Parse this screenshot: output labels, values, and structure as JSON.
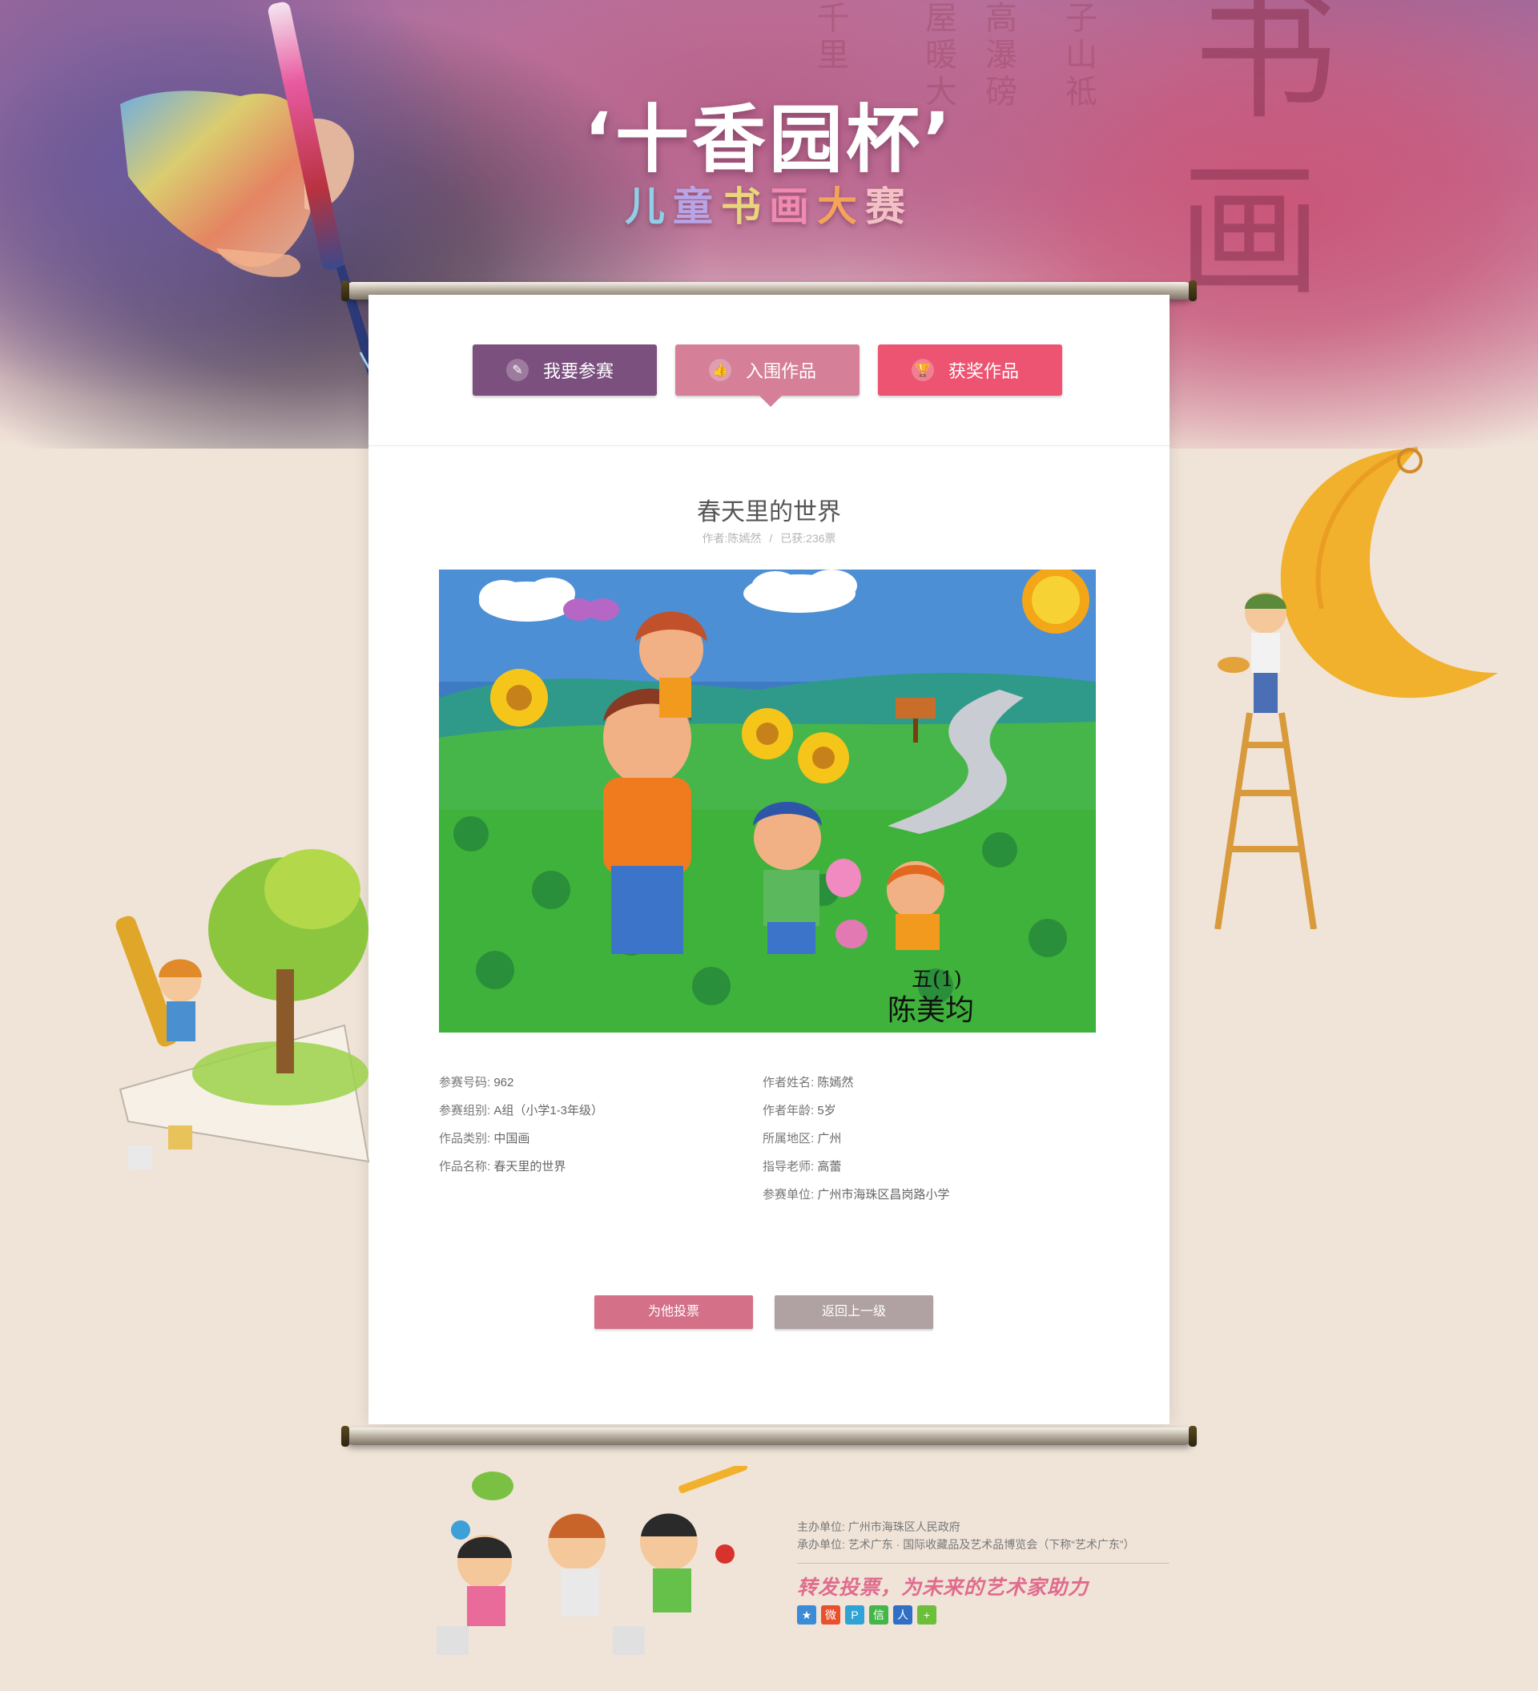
{
  "banner": {
    "title": "‘十香园杯’",
    "subtitle": [
      {
        "text": "儿",
        "color": "#8fcfe8"
      },
      {
        "text": "童",
        "color": "#b9a4e6"
      },
      {
        "text": "书",
        "color": "#e9d57a"
      },
      {
        "text": "画",
        "color": "#f08ab0"
      },
      {
        "text": "大",
        "color": "#f5a35a"
      },
      {
        "text": "赛",
        "color": "#f3c0c6"
      }
    ],
    "callig_1": "书",
    "callig_2": "画",
    "poem_cols": [
      "子山祗",
      "高瀑磅",
      "屋暖大",
      "千里"
    ]
  },
  "tabs": [
    {
      "label": "我要参赛",
      "icon": "brush-icon",
      "glyph": "✎"
    },
    {
      "label": "入围作品",
      "icon": "thumbs-up-icon",
      "glyph": "👍"
    },
    {
      "label": "获奖作品",
      "icon": "trophy-icon",
      "glyph": "🏆"
    }
  ],
  "work": {
    "title": "春天里的世界",
    "author_meta": "作者:陈嫣然",
    "votes_meta": "已获:236票",
    "artwork_signature_1": "五(1)",
    "artwork_signature_2": "陈美均"
  },
  "info_left": [
    {
      "k": "参赛号码:",
      "v": "962"
    },
    {
      "k": "参赛组别:",
      "v": "A组（小学1-3年级）"
    },
    {
      "k": "作品类别:",
      "v": "中国画"
    },
    {
      "k": "作品名称:",
      "v": "春天里的世界"
    }
  ],
  "info_right": [
    {
      "k": "作者姓名:",
      "v": "陈嫣然"
    },
    {
      "k": "作者年龄:",
      "v": "5岁"
    },
    {
      "k": "所属地区:",
      "v": "广州"
    },
    {
      "k": "指导老师:",
      "v": "高蕾"
    },
    {
      "k": "参赛单位:",
      "v": "广州市海珠区昌岗路小学"
    }
  ],
  "buttons": {
    "vote": "为他投票",
    "back": "返回上一级"
  },
  "footer": {
    "host": "主办单位:   广州市海珠区人民政府",
    "organizer": "承办单位:   艺术广东 · 国际收藏品及艺术品博览会（下称“艺术广东”）",
    "slogan": "转发投票，为未来的艺术家助力",
    "share": [
      {
        "icon": "qzone-icon",
        "color": "#3b8bd6",
        "glyph": "★"
      },
      {
        "icon": "weibo-icon",
        "color": "#e8502e",
        "glyph": "微"
      },
      {
        "icon": "tencent-weibo-icon",
        "color": "#2fa3d8",
        "glyph": "P"
      },
      {
        "icon": "wechat-icon",
        "color": "#44b549",
        "glyph": "信"
      },
      {
        "icon": "renren-icon",
        "color": "#2f6fc7",
        "glyph": "人"
      },
      {
        "icon": "more-share-icon",
        "color": "#6cbf3a",
        "glyph": "+"
      }
    ]
  }
}
